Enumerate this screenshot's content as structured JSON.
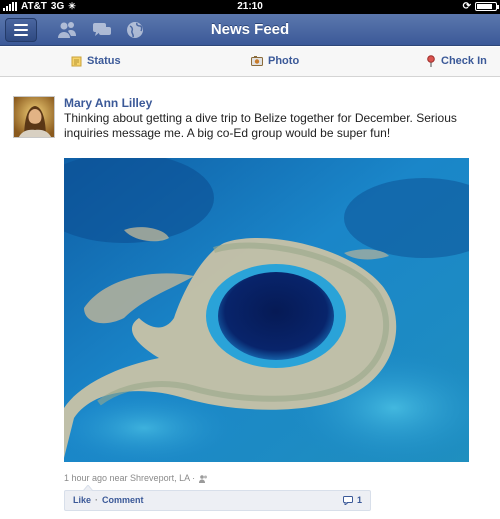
{
  "status_bar": {
    "carrier": "AT&T",
    "network": "3G",
    "time": "21:10",
    "battery_level": 0.85
  },
  "nav": {
    "title": "News Feed",
    "icons": [
      "menu-icon",
      "friend-requests-icon",
      "messages-icon",
      "notifications-globe-icon"
    ]
  },
  "actions": {
    "status_label": "Status",
    "photo_label": "Photo",
    "checkin_label": "Check In"
  },
  "post": {
    "author": "Mary Ann Lilley",
    "text": "Thinking about getting a dive trip to Belize together for December. Serious inquiries message me. A big co-Ed group would be super fun!",
    "meta": "1 hour ago near Shreveport, LA ·",
    "like_label": "Like",
    "separator": "·",
    "comment_label": "Comment",
    "comment_count": "1"
  },
  "colors": {
    "brand": "#3b5998",
    "nav_gradient_top": "#5b77ad",
    "ocean_deep": "#08246b",
    "ocean_shallow": "#2aa3d8"
  }
}
